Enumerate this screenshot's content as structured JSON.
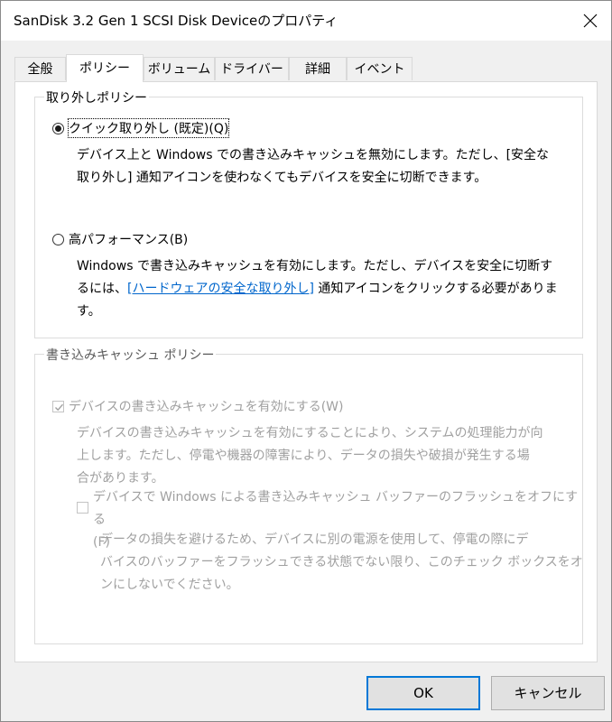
{
  "window": {
    "title": "SanDisk 3.2 Gen 1 SCSI Disk Deviceのプロパティ"
  },
  "tabs": [
    {
      "label": "全般"
    },
    {
      "label": "ポリシー",
      "active": true
    },
    {
      "label": "ボリューム"
    },
    {
      "label": "ドライバー"
    },
    {
      "label": "詳細"
    },
    {
      "label": "イベント"
    }
  ],
  "removal_policy": {
    "label": "取り外しポリシー",
    "quick": {
      "label": "クイック取り外し (既定)(Q)",
      "selected": true,
      "desc_line1": "デバイス上と Windows での書き込みキャッシュを無効にします。ただし、[安全な",
      "desc_line2": "取り外し] 通知アイコンを使わなくてもデバイスを安全に切断できます。"
    },
    "performance": {
      "label": "高パフォーマンス(B)",
      "selected": false,
      "desc_line1": "Windows で書き込みキャッシュを有効にします。ただし、デバイスを安全に切断す",
      "desc_line2_pre": "るには、",
      "desc_link": "[ハードウェアの安全な取り外し]",
      "desc_line2_post": " 通知アイコンをクリックする必要がありま",
      "desc_line3": "す。"
    }
  },
  "write_cache_policy": {
    "label": "書き込みキャッシュ ポリシー",
    "enable": {
      "label": "デバイスの書き込みキャッシュを有効にする(W)",
      "checked": true,
      "desc_line1": "デバイスの書き込みキャッシュを有効にすることにより、システムの処理能力が向",
      "desc_line2": "上します。ただし、停電や機器の障害により、データの損失や破損が発生する場",
      "desc_line3": "合があります。"
    },
    "flush_off": {
      "label_line1": "デバイスで Windows による書き込みキャッシュ バッファーのフラッシュをオフにする",
      "label_line2": "(F)",
      "checked": false,
      "desc_line1": "データの損失を避けるため、デバイスに別の電源を使用して、停電の際にデ",
      "desc_line2": "バイスのバッファーをフラッシュできる状態でない限り、このチェック ボックスをオ",
      "desc_line3": "ンにしないでください。"
    }
  },
  "buttons": {
    "ok": "OK",
    "cancel": "キャンセル"
  },
  "colors": {
    "link": "#0066cc",
    "default_button_border": "#0078d7",
    "disabled_text": "#a0a0a0"
  }
}
